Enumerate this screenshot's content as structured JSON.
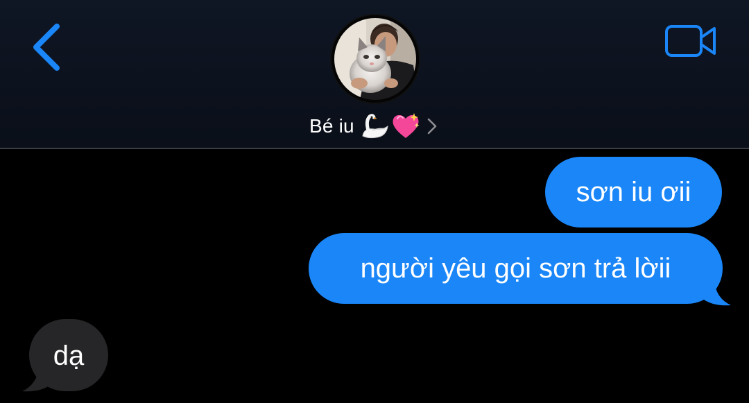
{
  "header": {
    "contact_name": "Bé iu",
    "emojis": [
      "swan-emoji",
      "sparkling-heart-emoji"
    ],
    "back_icon": "chevron-left-icon",
    "video_icon": "video-camera-icon",
    "name_chevron_icon": "chevron-right-icon",
    "accent_color": "#1a86f8"
  },
  "messages": [
    {
      "direction": "outgoing",
      "text": "sơn iu ơii"
    },
    {
      "direction": "outgoing",
      "text": "người yêu gọi sơn trả lờii"
    },
    {
      "direction": "incoming",
      "text": "dạ"
    }
  ],
  "colors": {
    "outgoing_bubble": "#1a86f8",
    "incoming_bubble": "#262629",
    "background": "#000000",
    "header_background": "#0d1320"
  }
}
